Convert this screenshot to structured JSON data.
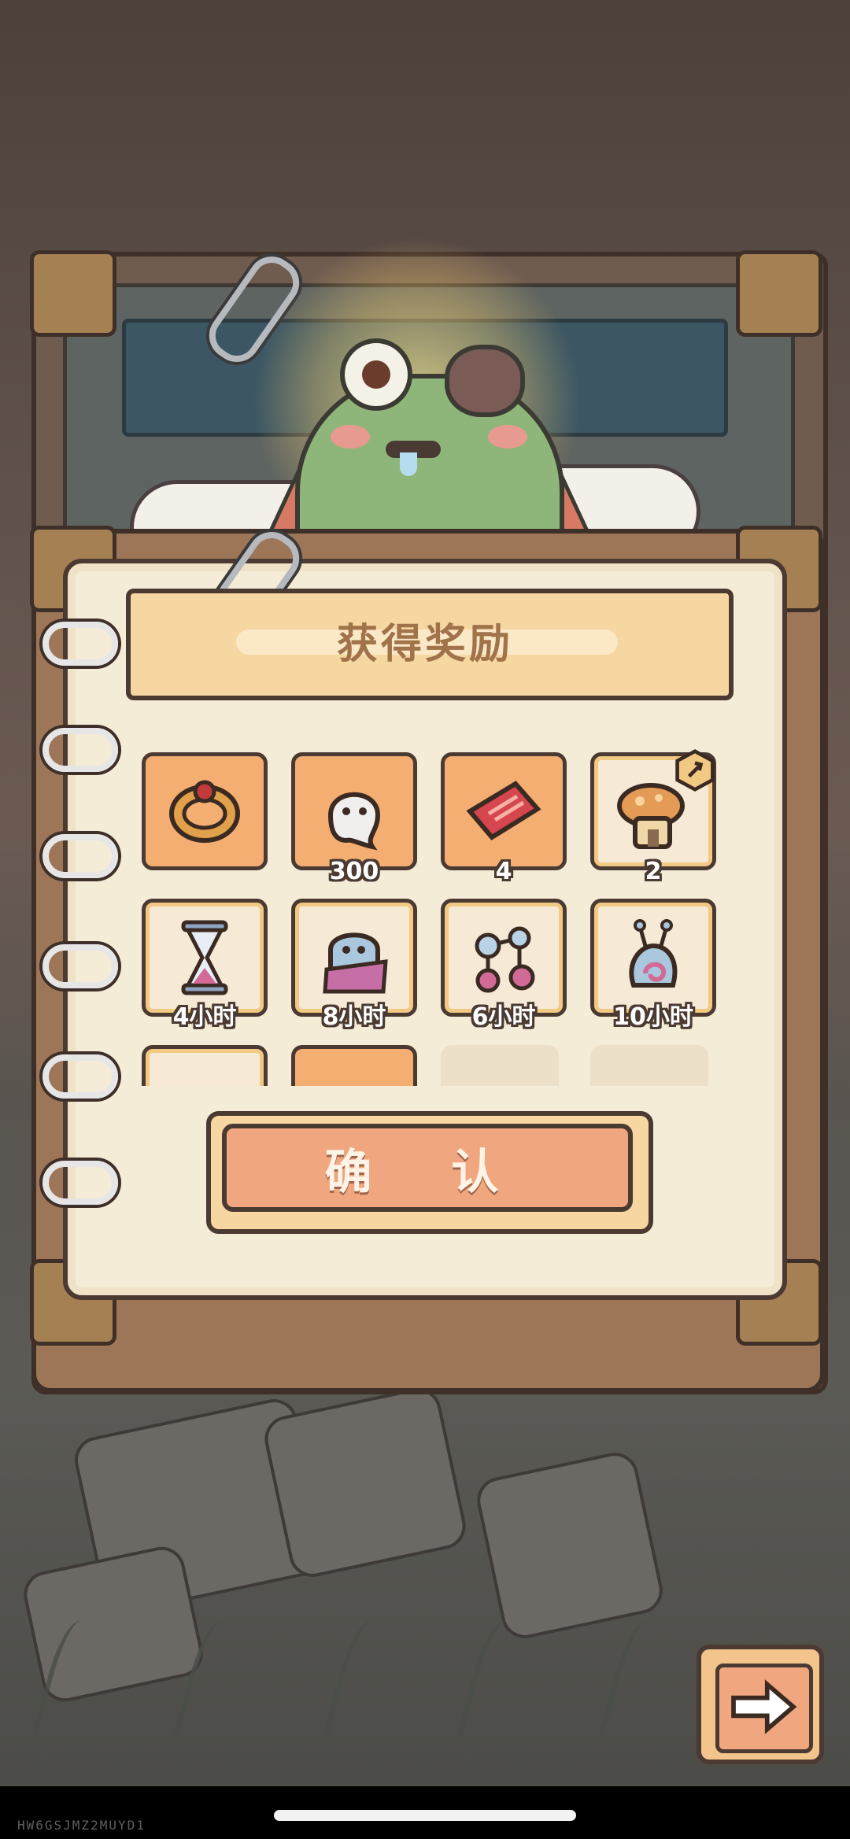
{
  "dialog": {
    "title": "获得奖励",
    "confirm_label": "确    认"
  },
  "rewards": [
    {
      "name": "ring",
      "quantity": ""
    },
    {
      "name": "ghost-soul",
      "quantity": "300"
    },
    {
      "name": "ticket",
      "quantity": "4"
    },
    {
      "name": "mushroom-house",
      "quantity": "2"
    },
    {
      "name": "hourglass",
      "quantity": "4小时"
    },
    {
      "name": "ghost-cloak",
      "quantity": "8小时"
    },
    {
      "name": "molecule-flask",
      "quantity": "6小时"
    },
    {
      "name": "snail-flask",
      "quantity": "10小时"
    }
  ],
  "watermark": "HW6GSJMZ2MUYD1",
  "colors": {
    "orange_slot": "#f4ae72",
    "light_slot": "#f6ead6",
    "paper": "#f5ecd8",
    "button": "#f0a77f",
    "title_text": "#a0734a"
  }
}
